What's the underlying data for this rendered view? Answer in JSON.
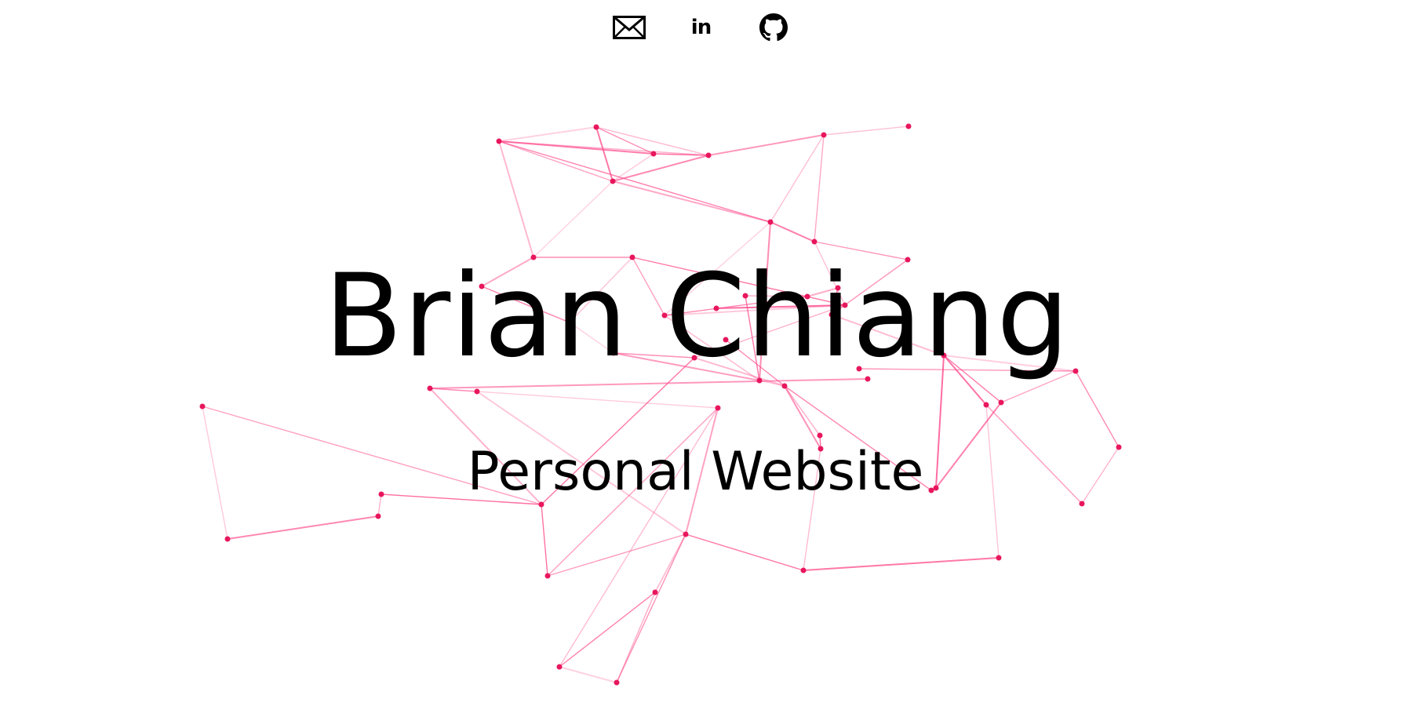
{
  "hero": {
    "title": "Brian Chiang",
    "subtitle": "Personal Website"
  },
  "social": [
    {
      "name": "email",
      "icon": "envelope-icon"
    },
    {
      "name": "linkedin",
      "icon": "linkedin-icon",
      "glyph": "in"
    },
    {
      "name": "github",
      "icon": "github-icon"
    }
  ],
  "colors": {
    "background": "#ffffff",
    "text": "#000000",
    "network_line": "#ff4d8d",
    "network_node": "#e8175d"
  },
  "background": {
    "type": "particle-network"
  }
}
